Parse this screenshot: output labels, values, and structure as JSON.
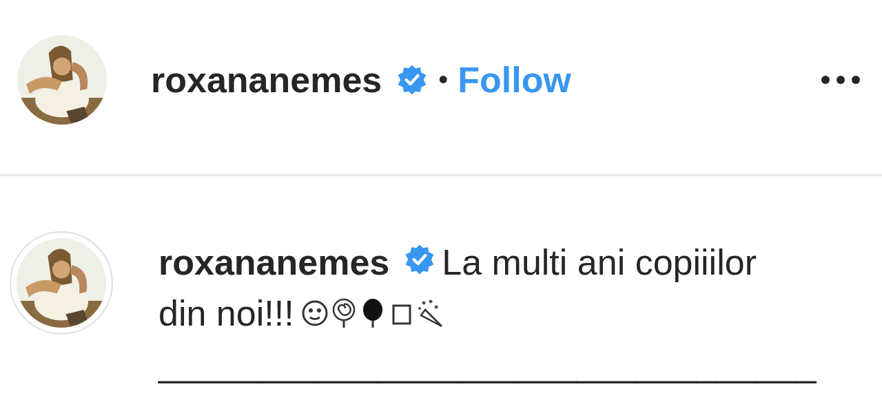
{
  "header": {
    "username": "roxananemes",
    "verified": true,
    "separator": "•",
    "follow": "Follow"
  },
  "caption": {
    "username": "roxananemes",
    "verified": true,
    "text_lines": [
      "La multi ani copiiilor",
      "din noi!!!"
    ],
    "rule": "_________________________________"
  }
}
